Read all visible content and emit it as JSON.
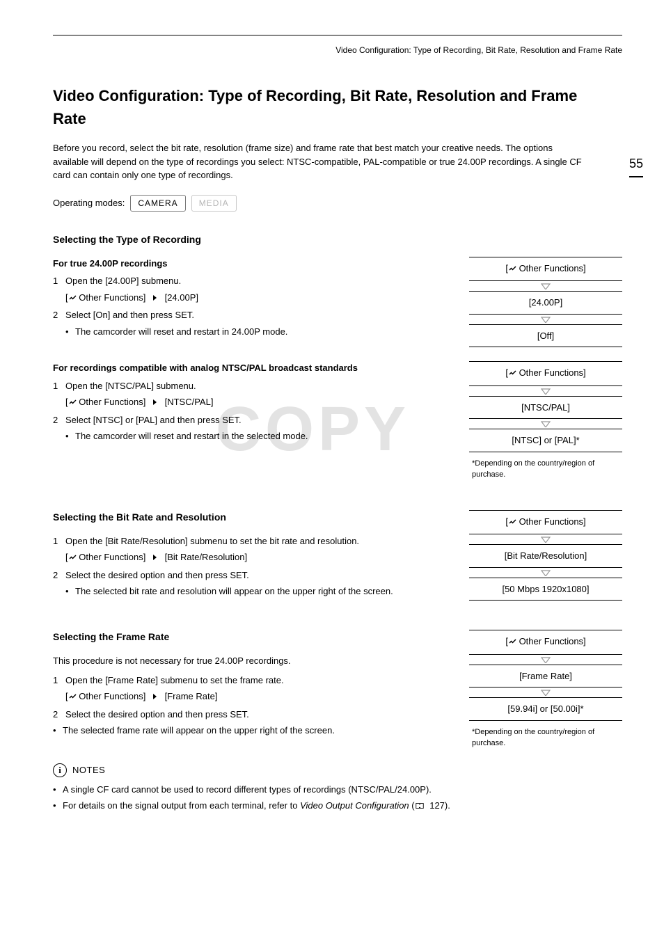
{
  "runningHead": "Video Configuration: Type of Recording, Bit Rate, Resolution and Frame Rate",
  "pageNumber": "55",
  "title": "Video Configuration: Type of Recording, Bit Rate, Resolution and Frame Rate",
  "intro": "Before you record, select the bit rate, resolution (frame size) and frame rate that best match your creative needs. The options available will depend on the type of recordings you select: NTSC-compatible, PAL-compatible or true 24.00P recordings. A single CF card can contain only one type of recordings.",
  "operatingModesLabel": "Operating modes:",
  "modeCamera": "CAMERA",
  "modeMedia": "MEDIA",
  "watermark": "COPY",
  "sectA": {
    "head": "Selecting the Type of Recording",
    "block1": {
      "subhead": "For true 24.00P recordings",
      "step1": "Open the [24.00P] submenu.",
      "menu1a": " Other Functions]",
      "menu1b": "[24.00P]",
      "step2": "Select [On] and then press SET.",
      "bullet2": "The camcorder will reset and restart in 24.00P mode."
    },
    "menuR1": {
      "row1": " Other Functions]",
      "row2": "[24.00P]",
      "row3": "[Off]"
    },
    "block2": {
      "subhead": "For recordings compatible with analog NTSC/PAL broadcast standards",
      "step1": "Open the [NTSC/PAL] submenu.",
      "menu1a": " Other Functions]",
      "menu1b": "[NTSC/PAL]",
      "step2": "Select [NTSC] or [PAL] and then press SET.",
      "bullet2": "The camcorder will reset and restart in the selected mode."
    },
    "menuR2": {
      "row1": " Other Functions]",
      "row2": "[NTSC/PAL]",
      "row3": "[NTSC] or [PAL]*",
      "note": "*Depending on the country/region of purchase."
    }
  },
  "sectB": {
    "head": "Selecting the Bit Rate and Resolution",
    "step1": "Open the [Bit Rate/Resolution] submenu to set the bit rate and resolution.",
    "menu1a": " Other Functions]",
    "menu1b": "[Bit Rate/Resolution]",
    "step2": "Select the desired option and then press SET.",
    "bullet2": "The selected bit rate and resolution will appear on the upper right of the screen.",
    "menuR": {
      "row1": " Other Functions]",
      "row2": "[Bit Rate/Resolution]",
      "row3": "[50 Mbps 1920x1080]"
    }
  },
  "sectC": {
    "head": "Selecting the Frame Rate",
    "note": "This procedure is not necessary for true 24.00P recordings.",
    "step1": "Open the [Frame Rate] submenu to set the frame rate.",
    "menu1a": " Other Functions]",
    "menu1b": "[Frame Rate]",
    "step2": "Select the desired option and then press SET.",
    "outerBullet": "The selected frame rate will appear on the upper right of the screen.",
    "menuR": {
      "row1": " Other Functions]",
      "row2": "[Frame Rate]",
      "row3": "[59.94i] or [50.00i]*",
      "note": "*Depending on the country/region of purchase."
    }
  },
  "notes": {
    "label": "NOTES",
    "b1": "A single CF card cannot be used to record different types of recordings (NTSC/PAL/24.00P).",
    "b2a": "For details on the signal output from each terminal, refer to ",
    "b2b": "Video Output Configuration",
    "b2c": " (",
    "b2d": " 127)."
  }
}
